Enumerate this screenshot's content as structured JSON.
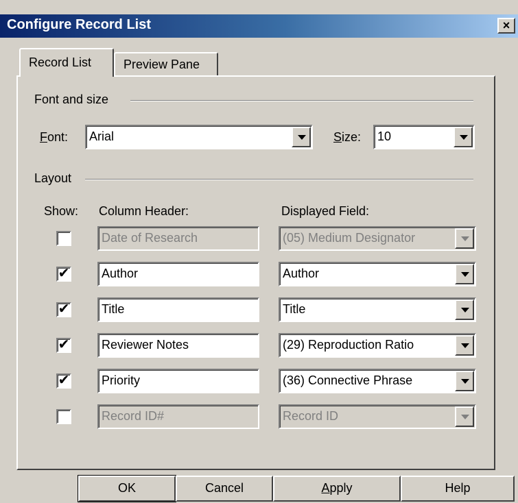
{
  "window": {
    "title": "Configure Record List",
    "close_label": "×"
  },
  "tabs": [
    {
      "label": "Record List",
      "selected": true
    },
    {
      "label": "Preview Pane",
      "selected": false
    }
  ],
  "font_group": {
    "label": "Font and size",
    "font_label_prefix": "",
    "font_label_access": "F",
    "font_label_rest": "ont:",
    "font_value": "Arial",
    "size_label_access": "S",
    "size_label_rest": "ize:",
    "size_value": "10"
  },
  "layout_group": {
    "label": "Layout",
    "show_header": "Show:",
    "column_header": "Column Header:",
    "displayed_field_header": "Displayed Field:",
    "rows": [
      {
        "checked": false,
        "enabled": false,
        "header": "Date of Research",
        "field": "(05) Medium Designator"
      },
      {
        "checked": true,
        "enabled": true,
        "header": "Author",
        "field": "Author"
      },
      {
        "checked": true,
        "enabled": true,
        "header": "Title",
        "field": "Title"
      },
      {
        "checked": true,
        "enabled": true,
        "header": "Reviewer Notes",
        "field": "(29) Reproduction Ratio"
      },
      {
        "checked": true,
        "enabled": true,
        "header": "Priority",
        "field": "(36) Connective Phrase"
      },
      {
        "checked": false,
        "enabled": false,
        "header": "Record ID#",
        "field": "Record ID"
      }
    ]
  },
  "buttons": {
    "ok": "OK",
    "cancel": "Cancel",
    "apply_access": "A",
    "apply_rest": "pply",
    "help": "Help"
  },
  "icons": {
    "checkmark": "✔",
    "dropdown": "dropdown-arrow-icon"
  }
}
